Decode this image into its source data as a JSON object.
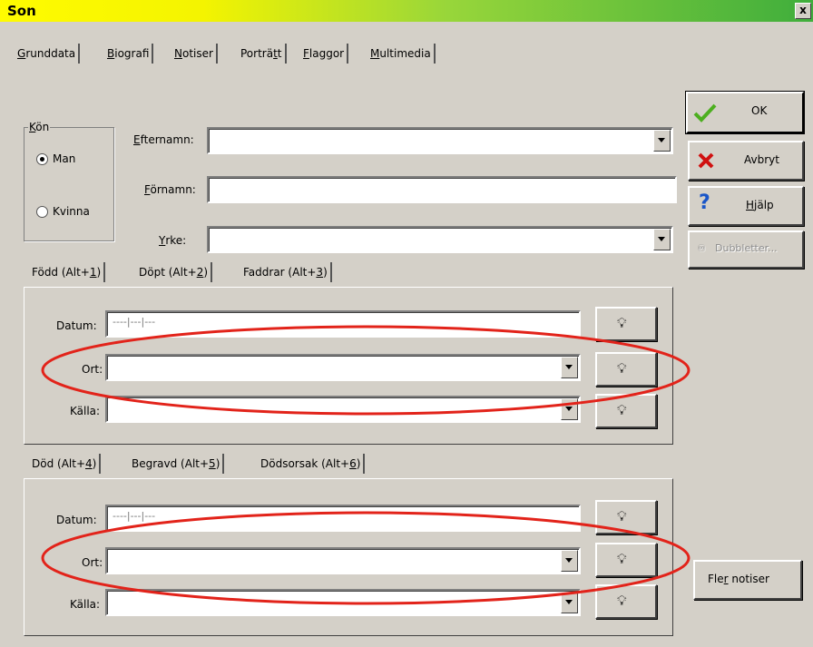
{
  "window": {
    "title": "Son",
    "close": "x"
  },
  "tabs": [
    {
      "mnemonic": "G",
      "rest": "runddata"
    },
    {
      "mnemonic": "B",
      "rest": "iografi"
    },
    {
      "mnemonic": "N",
      "rest": "otiser"
    },
    {
      "pre": "Porträ",
      "mnemonic": "t",
      "rest": "t"
    },
    {
      "mnemonic": "F",
      "rest": "laggor"
    },
    {
      "mnemonic": "M",
      "rest": "ultimedia"
    }
  ],
  "gender": {
    "legend_m": "K",
    "legend_rest": "ön",
    "options": [
      "Man",
      "Kvinna"
    ],
    "selected": "Man"
  },
  "names": {
    "efternamn": {
      "m": "E",
      "rest": "fternamn:",
      "value": ""
    },
    "fornamn": {
      "m": "F",
      "rest": "örnamn:",
      "value": ""
    },
    "yrke": {
      "m": "Y",
      "rest": "rke:",
      "value": ""
    }
  },
  "buttons": {
    "ok": "OK",
    "avbryt": "Avbryt",
    "help_m": "H",
    "help_rest": "jälp",
    "dubbletter": "Dubbletter...",
    "fler": "Fle",
    "fler_m": "r",
    "fler_rest": " notiser"
  },
  "birth_tabs": [
    {
      "label": "Född  (Alt+",
      "m": "1",
      "end": ")"
    },
    {
      "label": "Döpt  (Alt+",
      "m": "2",
      "end": ")"
    },
    {
      "label": "Faddrar  (Alt+",
      "m": "3",
      "end": ")"
    }
  ],
  "death_tabs": [
    {
      "label": "Död  (Alt+",
      "m": "4",
      "end": ")"
    },
    {
      "label": "Begravd  (Alt+",
      "m": "5",
      "end": ")"
    },
    {
      "label": "Dödsorsak  (Alt+",
      "m": "6",
      "end": ")"
    }
  ],
  "birth": {
    "datum_label": "Datum:",
    "ort_label": "Ort:",
    "kalla_label": "Källa:",
    "datum": "----|---|---",
    "ort": "",
    "kalla": ""
  },
  "death": {
    "datum_label": "Datum:",
    "ort_label": "Ort:",
    "kalla_label": "Källa:",
    "datum": "----|---|---",
    "ort": "",
    "kalla": ""
  },
  "colors": {
    "highlight": "#e2231a",
    "ok_check": "#4caf1f",
    "cancel_x": "#d01010",
    "help_q": "#1a56c8"
  }
}
